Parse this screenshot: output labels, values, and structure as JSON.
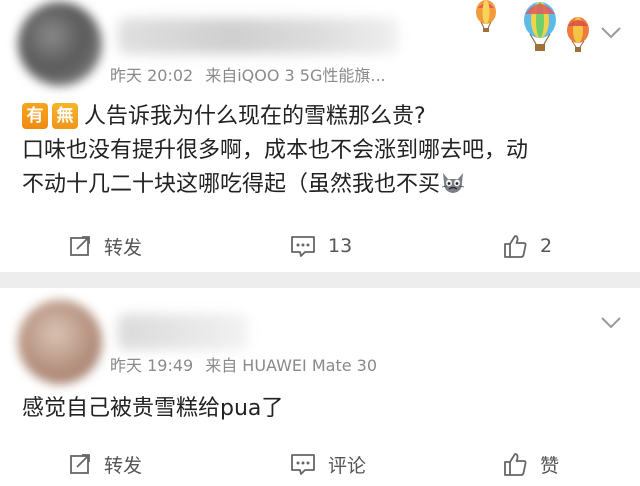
{
  "posts": [
    {
      "meta": {
        "time": "昨天 20:02",
        "source": "来自iQOO 3 5G性能旗..."
      },
      "content": {
        "tag_1": "有",
        "tag_2": "無",
        "line_1": "人告诉我为什么现在的雪糕那么贵?",
        "line_2": "口味也没有提升很多啊，成本也不会涨到哪去吧，动",
        "line_3": "不动十几二十块这哪吃得起（虽然我也不买"
      },
      "actions": {
        "repost_label": "转发",
        "comment_count": "13",
        "like_count": "2"
      }
    },
    {
      "meta": {
        "time": "昨天 19:49",
        "source": "来自 HUAWEI Mate 30"
      },
      "content": {
        "line_1": "感觉自己被贵雪糕给pua了"
      },
      "actions": {
        "repost_label": "转发",
        "comment_label": "评论",
        "like_label": "赞"
      }
    }
  ],
  "icons": [
    "chevron-down-icon",
    "hot-air-balloons-icon",
    "repost-icon",
    "comment-icon",
    "like-icon",
    "cat-emoji-icon"
  ],
  "colors": {
    "meta_text": "#8a8a8a",
    "tag_orange": "#f08a12",
    "separator": "#ededed",
    "action_text": "#555555"
  }
}
